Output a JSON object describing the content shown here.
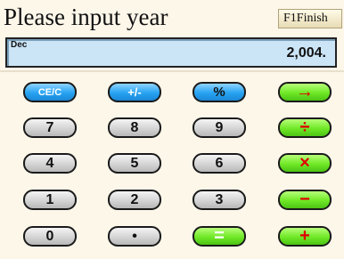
{
  "header": {
    "title": "Please input year",
    "finish_label": "F1Finish"
  },
  "display": {
    "mode": "Dec",
    "value": "2,004."
  },
  "keys": {
    "ce": "CE/C",
    "sign": "+/-",
    "percent": "%",
    "backspace": "→",
    "seven": "7",
    "eight": "8",
    "nine": "9",
    "divide": "÷",
    "four": "4",
    "five": "5",
    "six": "6",
    "multiply": "×",
    "one": "1",
    "two": "2",
    "three": "3",
    "minus": "−",
    "zero": "0",
    "dot": "•",
    "equals": "=",
    "plus": "+"
  },
  "colors": {
    "blue": "#27a3f2",
    "green": "#6fe826",
    "gray": "#d4d4d4",
    "display": "#cbe5f6",
    "background": "#fdf7ea"
  }
}
